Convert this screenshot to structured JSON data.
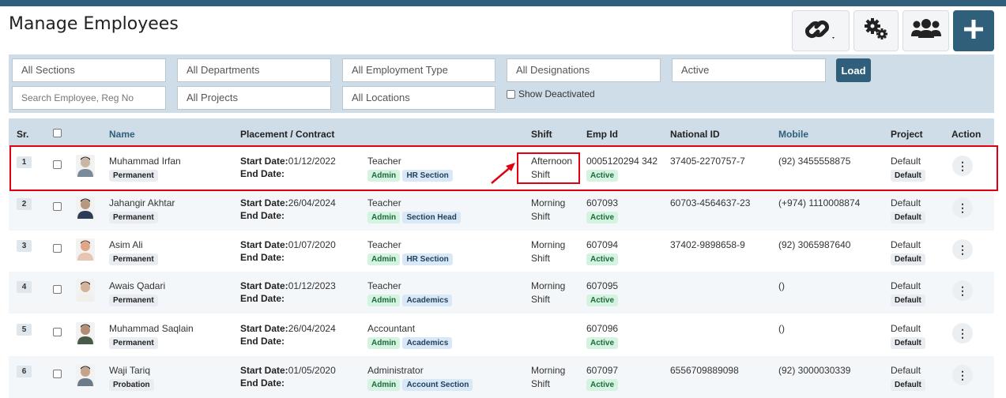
{
  "page": {
    "title": "Manage Employees"
  },
  "toolbar": {
    "link_icon": "link-icon",
    "settings_icon": "gears-icon",
    "users_icon": "users-icon",
    "add_icon": "plus-icon",
    "brand_color": "#2f5f7a"
  },
  "filters": {
    "sections": "All Sections",
    "departments": "All Departments",
    "employment_type": "All Employment Type",
    "designations": "All Designations",
    "status": "Active",
    "search_placeholder": "Search Employee, Reg No",
    "projects": "All Projects",
    "locations": "All Locations",
    "show_deactivated": "Show Deactivated",
    "load": "Load"
  },
  "table": {
    "headers": {
      "sr": "Sr.",
      "name": "Name",
      "placement": "Placement / Contract",
      "shift": "Shift",
      "emp_id": "Emp Id",
      "national_id": "National ID",
      "mobile": "Mobile",
      "project": "Project",
      "action": "Action"
    },
    "rows": [
      {
        "sr": "1",
        "name": "Muhammad Irfan",
        "type": "Permanent",
        "start_label": "Start Date:",
        "start": "01/12/2022",
        "end_label": "End Date:",
        "designation": "Teacher",
        "dept": "Admin",
        "section": "HR Section",
        "shift1": "Afternoon",
        "shift2": "Shift",
        "emp_id": "0005120294 342",
        "status": "Active",
        "national_id": "37405-2270757-7",
        "mobile": "(92) 3455558875",
        "project": "Default",
        "project_badge": "Default",
        "action": "⋮"
      },
      {
        "sr": "2",
        "name": "Jahangir Akhtar",
        "type": "Permanent",
        "start_label": "Start Date:",
        "start": "26/04/2024",
        "end_label": "End Date:",
        "designation": "Teacher",
        "dept": "Admin",
        "section": "Section Head",
        "shift1": "Morning",
        "shift2": "Shift",
        "emp_id": "607093",
        "status": "Active",
        "national_id": "60703-4564637-23",
        "mobile": "(+974) 1110008874",
        "project": "Default",
        "project_badge": "Default",
        "action": "⋮"
      },
      {
        "sr": "3",
        "name": "Asim Ali",
        "type": "Permanent",
        "start_label": "Start Date:",
        "start": "01/07/2020",
        "end_label": "End Date:",
        "designation": "Teacher",
        "dept": "Admin",
        "section": "HR Section",
        "shift1": "Morning",
        "shift2": "Shift",
        "emp_id": "607094",
        "status": "Active",
        "national_id": "37402-9898658-9",
        "mobile": "(92) 3065987640",
        "project": "Default",
        "project_badge": "Default",
        "action": "⋮"
      },
      {
        "sr": "4",
        "name": "Awais Qadari",
        "type": "Permanent",
        "start_label": "Start Date:",
        "start": "01/12/2023",
        "end_label": "End Date:",
        "designation": "Teacher",
        "dept": "Admin",
        "section": "Academics",
        "shift1": "Morning",
        "shift2": "Shift",
        "emp_id": "607095",
        "status": "Active",
        "national_id": "",
        "mobile": "()",
        "project": "Default",
        "project_badge": "Default",
        "action": "⋮"
      },
      {
        "sr": "5",
        "name": "Muhammad Saqlain",
        "type": "Permanent",
        "start_label": "Start Date:",
        "start": "26/04/2024",
        "end_label": "End Date:",
        "designation": "Accountant",
        "dept": "Admin",
        "section": "Academics",
        "shift1": "",
        "shift2": "",
        "emp_id": "607096",
        "status": "Active",
        "national_id": "",
        "mobile": "()",
        "project": "Default",
        "project_badge": "Default",
        "action": "⋮"
      },
      {
        "sr": "6",
        "name": "Waji Tariq",
        "type": "Probation",
        "start_label": "Start Date:",
        "start": "01/05/2020",
        "end_label": "End Date:",
        "designation": "Administrator",
        "dept": "Admin",
        "section": "Account Section",
        "shift1": "Morning",
        "shift2": "Shift",
        "emp_id": "607097",
        "status": "Active",
        "national_id": "6556709889098",
        "mobile": "(92) 3000030339",
        "project": "Default",
        "project_badge": "Default",
        "action": "⋮"
      }
    ]
  },
  "annotation": {
    "highlight_color": "#e00012"
  }
}
